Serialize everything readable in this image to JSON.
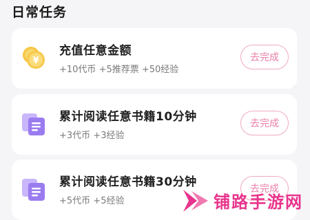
{
  "section": {
    "title": "日常任务"
  },
  "tasks": [
    {
      "title": "充值任意金额",
      "rewards": "+10代币 +5推荐票 +50经验",
      "action": "去完成",
      "icon": "coin-icon"
    },
    {
      "title": "累计阅读任意书籍10分钟",
      "rewards": "+3代币 +3经验",
      "action": "去完成",
      "icon": "books-icon"
    },
    {
      "title": "累计阅读任意书籍30分钟",
      "rewards": "+5代币 +5经验",
      "action": "去完成",
      "icon": "books-icon"
    }
  ],
  "watermark": {
    "text": "铺路手游网"
  },
  "colors": {
    "accent": "#e97fa8",
    "accent_border": "#f0a8c6",
    "watermark": "#e8348c",
    "coin": "#f7c94b",
    "books": "#9b7cf0"
  }
}
